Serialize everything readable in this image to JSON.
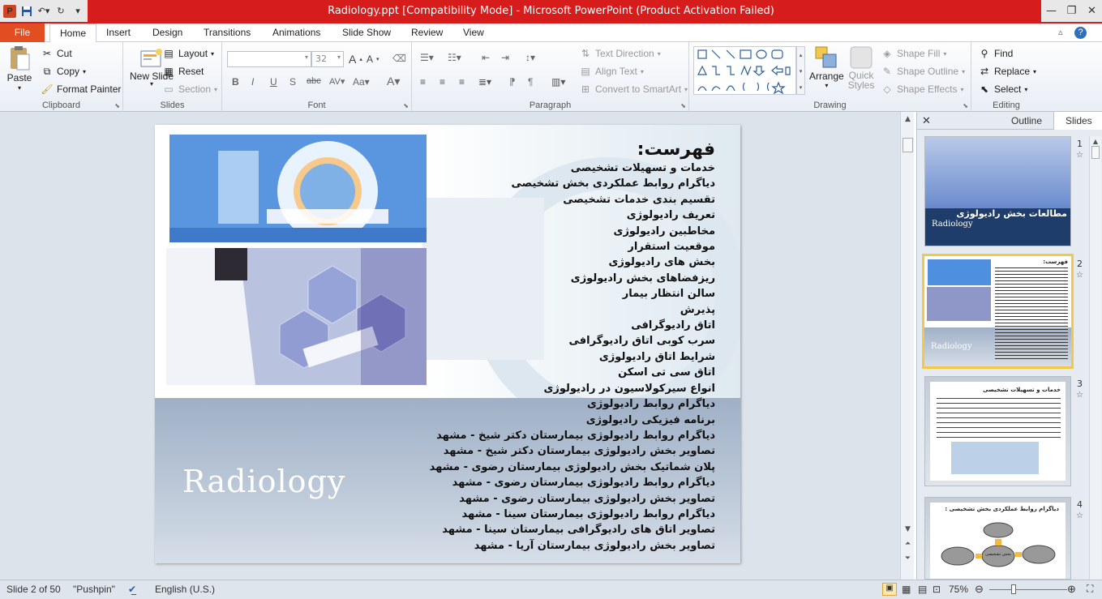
{
  "window": {
    "title": "Radiology.ppt [Compatibility Mode]  -  Microsoft PowerPoint (Product Activation Failed)"
  },
  "qat": {
    "app_icon": "P"
  },
  "tabs": [
    {
      "label": "File"
    },
    {
      "label": "Home"
    },
    {
      "label": "Insert"
    },
    {
      "label": "Design"
    },
    {
      "label": "Transitions"
    },
    {
      "label": "Animations"
    },
    {
      "label": "Slide Show"
    },
    {
      "label": "Review"
    },
    {
      "label": "View"
    }
  ],
  "ribbon": {
    "clipboard": {
      "label": "Clipboard",
      "paste": "Paste",
      "cut": "Cut",
      "copy": "Copy",
      "format_painter": "Format Painter"
    },
    "slides": {
      "label": "Slides",
      "new_slide": "New Slide",
      "layout": "Layout",
      "reset": "Reset",
      "section": "Section"
    },
    "font": {
      "label": "Font",
      "size": "32"
    },
    "paragraph": {
      "label": "Paragraph",
      "text_direction": "Text Direction",
      "align_text": "Align Text",
      "convert_smartart": "Convert to SmartArt"
    },
    "drawing": {
      "label": "Drawing",
      "arrange": "Arrange",
      "quick_styles": "Quick Styles",
      "shape_fill": "Shape Fill",
      "shape_outline": "Shape Outline",
      "shape_effects": "Shape Effects"
    },
    "editing": {
      "label": "Editing",
      "find": "Find",
      "replace": "Replace",
      "select": "Select"
    }
  },
  "slide": {
    "heading": "فهرست:",
    "items": [
      "خدمات و تسهیلات تشخیصی",
      "دیاگرام روابط عملکردی بخش تشخیصی",
      "تقسیم بندی خدمات تشخیصی",
      "تعریف رادیولوژی",
      "مخاطبین رادیولوژی",
      "موقعیت استقرار",
      "بخش های رادیولوژی",
      "ریزفضاهای بخش رادیولوژی",
      "سالن انتظار بیمار",
      "پذیرش",
      "اتاق رادیوگرافی",
      "سرب کوبی اتاق رادیوگرافی",
      "شرایط اتاق رادیولوژی",
      "اتاق سی تی اسکن",
      "انواع سیرکولاسیون در رادیولوژی",
      "دیاگرام روابط رادیولوژی",
      "برنامه فیزیکی رادیولوژی",
      "دیاگرام روابط رادیولوژی بیمارستان دکتر شیخ - مشهد",
      "تصاویر بخش رادیولوژی بیمارستان دکتر شیخ - مشهد",
      "پلان شماتیک بخش رادیولوژی بیمارستان رضوی - مشهد",
      "دیاگرام روابط رادیولوژی بیمارستان رضوی - مشهد",
      "تصاویر بخش رادیولوژی بیمارستان رضوی - مشهد",
      "دیاگرام روابط رادیولوژی بیمارستان سینا - مشهد",
      "تصاویر اتاق های رادیوگرافی بیمارستان سینا - مشهد",
      "تصاویر بخش رادیولوژی بیمارستان آریا - مشهد"
    ],
    "watermark": "Radiology"
  },
  "panel": {
    "outline_tab": "Outline",
    "slides_tab": "Slides",
    "thumbs": [
      {
        "num": "1",
        "title": "مطالعات بخش رادیولوژی",
        "sub": "Radiology"
      },
      {
        "num": "2",
        "title": "فهرست:",
        "sub": "Radiology"
      },
      {
        "num": "3",
        "title": "خدمات و تسهیلات تشخیصی"
      },
      {
        "num": "4",
        "title": "دیاگرام روابط عملکردی بخش تشخیصی :",
        "center": "بخش تشخیصی"
      }
    ]
  },
  "status": {
    "slide": "Slide 2 of 50",
    "theme": "\"Pushpin\"",
    "language": "English (U.S.)",
    "zoom": "75%"
  }
}
